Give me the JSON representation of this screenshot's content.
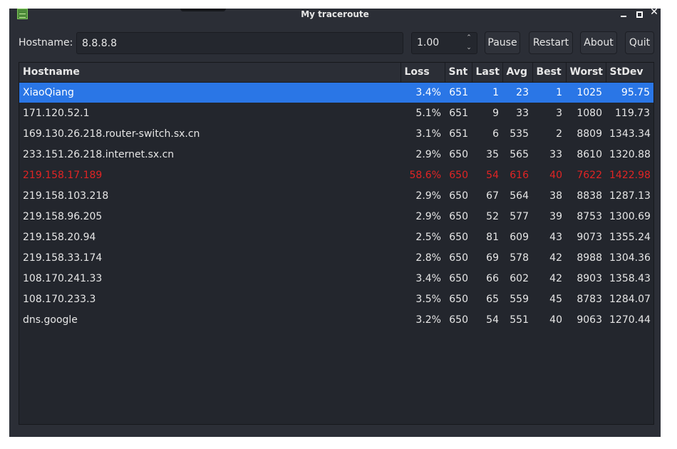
{
  "window": {
    "title": "My traceroute"
  },
  "toolbar": {
    "hostname_label": "Hostname:",
    "hostname_value": "8.8.8.8",
    "interval_value": "1.00",
    "pause_label": "Pause",
    "restart_label": "Restart",
    "about_label": "About",
    "quit_label": "Quit"
  },
  "table": {
    "columns": [
      "Hostname",
      "Loss",
      "Snt",
      "Last",
      "Avg",
      "Best",
      "Worst",
      "StDev"
    ],
    "selected_row": 0,
    "warning_row": 4,
    "rows": [
      [
        "XiaoQiang",
        "3.4%",
        "651",
        "1",
        "23",
        "1",
        "1025",
        "95.75"
      ],
      [
        "171.120.52.1",
        "5.1%",
        "651",
        "9",
        "33",
        "3",
        "1080",
        "119.73"
      ],
      [
        "169.130.26.218.router-switch.sx.cn",
        "3.1%",
        "651",
        "6",
        "535",
        "2",
        "8809",
        "1343.34"
      ],
      [
        "233.151.26.218.internet.sx.cn",
        "2.9%",
        "650",
        "35",
        "565",
        "33",
        "8610",
        "1320.88"
      ],
      [
        "219.158.17.189",
        "58.6%",
        "650",
        "54",
        "616",
        "40",
        "7622",
        "1422.98"
      ],
      [
        "219.158.103.218",
        "2.9%",
        "650",
        "67",
        "564",
        "38",
        "8838",
        "1287.13"
      ],
      [
        "219.158.96.205",
        "2.9%",
        "650",
        "52",
        "577",
        "39",
        "8753",
        "1300.69"
      ],
      [
        "219.158.20.94",
        "2.5%",
        "650",
        "81",
        "609",
        "43",
        "9073",
        "1355.24"
      ],
      [
        "219.158.33.174",
        "2.8%",
        "650",
        "69",
        "578",
        "42",
        "8988",
        "1304.36"
      ],
      [
        "108.170.241.33",
        "3.4%",
        "650",
        "66",
        "602",
        "42",
        "8903",
        "1358.43"
      ],
      [
        "108.170.233.3",
        "3.5%",
        "650",
        "65",
        "559",
        "45",
        "8783",
        "1284.07"
      ],
      [
        "dns.google",
        "3.2%",
        "650",
        "54",
        "551",
        "40",
        "9063",
        "1270.44"
      ]
    ]
  },
  "colors": {
    "background": "#2b2e36",
    "selection": "#2a76e6",
    "warning": "#e02424",
    "text": "#e6e6e6"
  }
}
